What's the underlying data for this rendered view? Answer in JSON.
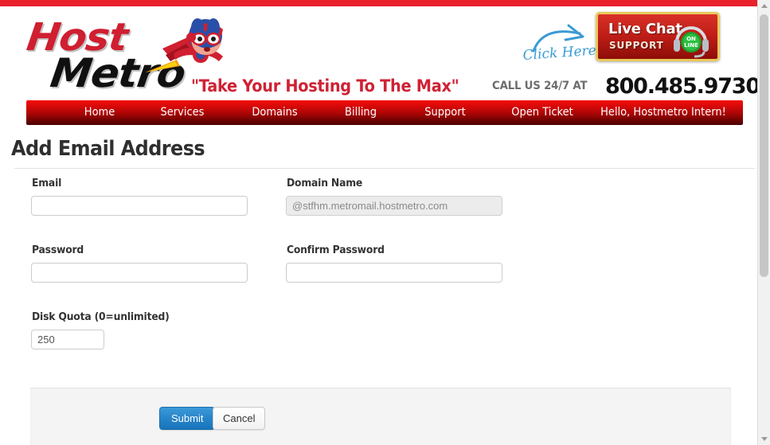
{
  "site": {
    "logo_line1": "Host",
    "logo_line2": "Metro",
    "mascot_icon": "superhero-mascot-icon",
    "tagline": "\"Take Your Hosting To The Max\"",
    "click_here": "Click Here",
    "click_here_arrow_icon": "curved-arrow-icon",
    "live_chat": {
      "title": "Live Chat",
      "subtitle": "SUPPORT",
      "status_line1": "ON",
      "status_line2": "LINE",
      "headset_icon": "headset-online-icon"
    },
    "call_label": "CALL US 24/7 AT",
    "phone": "800.485.9730"
  },
  "nav": {
    "items": [
      {
        "label": "Home"
      },
      {
        "label": "Services"
      },
      {
        "label": "Domains"
      },
      {
        "label": "Billing"
      },
      {
        "label": "Support"
      },
      {
        "label": "Open Ticket"
      },
      {
        "label": "Hello, Hostmetro Intern!"
      }
    ]
  },
  "main": {
    "title": "Add Email Address",
    "fields": {
      "email": {
        "label": "Email",
        "value": "",
        "placeholder": ""
      },
      "domain": {
        "label": "Domain Name",
        "value": "@stfhm.metromail.hostmetro.com",
        "disabled": true
      },
      "password": {
        "label": "Password",
        "value": "",
        "placeholder": ""
      },
      "confirm_password": {
        "label": "Confirm Password",
        "value": "",
        "placeholder": ""
      },
      "disk_quota": {
        "label": "Disk Quota (0=unlimited)",
        "value": "250",
        "placeholder": ""
      }
    },
    "actions": {
      "submit": "Submit",
      "cancel": "Cancel"
    }
  },
  "colors": {
    "brand_red": "#e8212a",
    "nav_red_top": "#f40d0d",
    "nav_red_bottom": "#4d0000",
    "tagline_red": "#cf2235",
    "logo_red": "#cf1f30",
    "submit_blue": "#1874bb",
    "click_here_blue": "#3b9ad4",
    "badge_gold": "#e8c95a"
  }
}
